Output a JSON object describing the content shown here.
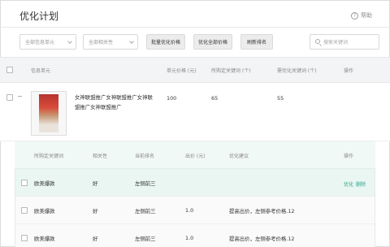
{
  "page": {
    "title": "优化计划",
    "help_label": "帮助"
  },
  "toolbar": {
    "filter_unit": "全部信息单元",
    "filter_relevance": "全部相关性",
    "batch_price_button": "批量优化价格",
    "optimize_all_button": "优化全部价格",
    "refresh_rank_button": "刷新排名",
    "search_placeholder": "搜索关键词"
  },
  "table": {
    "headers": {
      "unit": "信息单元",
      "unit_price": "单元价格 (元)",
      "bought_kw": "所购定关键词 (个)",
      "need_opt_kw": "需优化关键词 (个)",
      "action": "操作"
    },
    "row": {
      "collapse": "−",
      "name": "女神联盟推广女神联盟推广女神联盟推广女神联盟推广",
      "unit_price": "100",
      "bought_kw": "65",
      "need_opt_kw": "55"
    }
  },
  "subtable": {
    "headers": {
      "keyword": "所购定关键词",
      "relevance": "相关性",
      "rank": "当前排名",
      "bid": "出价 (元)",
      "suggestion": "优化建议",
      "action": "操作"
    },
    "rows": [
      {
        "keyword": "欧美爆款",
        "relevance": "好",
        "rank": "左侧前三",
        "bid": "",
        "suggestion": "",
        "action_optimize": "优化",
        "action_delete": "删除"
      },
      {
        "keyword": "欧美爆款",
        "relevance": "好",
        "rank": "左侧前三",
        "bid": "1.0",
        "suggestion": "提高出价，左侧参考价格.12"
      },
      {
        "keyword": "欧美爆款",
        "relevance": "好",
        "rank": "左侧前三",
        "bid": "1.0",
        "suggestion": "提高出价，左侧参考价格.12"
      }
    ]
  },
  "colors": {
    "accent": "#2aa78d",
    "header_bg": "#f3f4f5",
    "highlight_bg": "#e9f6f1"
  }
}
